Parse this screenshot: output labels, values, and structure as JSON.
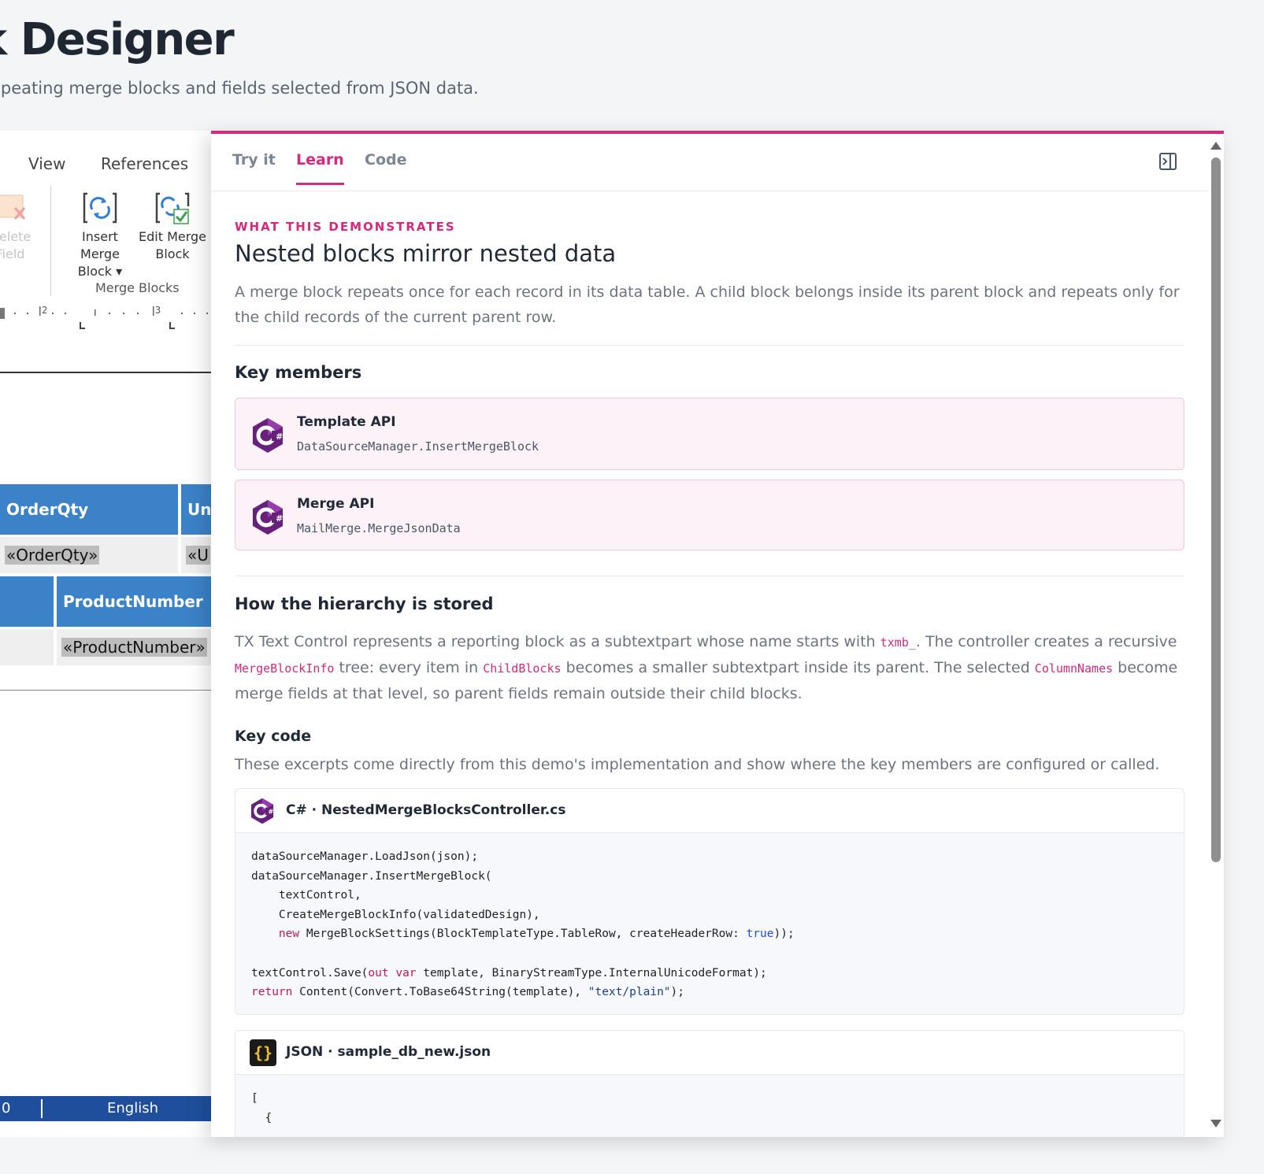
{
  "page": {
    "title": "k Designer",
    "subtitle": "epeating merge blocks and fields selected from JSON data."
  },
  "editor": {
    "ribbon_tabs": [
      "View",
      "References"
    ],
    "buttons": {
      "delete_field": [
        "Delete",
        "Field"
      ],
      "insert_merge_block": [
        "Insert Merge",
        "Block ▾"
      ],
      "edit_merge_block": [
        "Edit Merge",
        "Block"
      ]
    },
    "group_label": "Merge Blocks",
    "ruler_marks": [
      "2",
      "3"
    ],
    "table1": {
      "headers": [
        "OrderQty",
        "Un"
      ],
      "fields": [
        "«OrderQty»",
        "«U"
      ]
    },
    "table2": {
      "headers": [
        "ProductNumber"
      ],
      "fields": [
        "«ProductNumber»"
      ]
    },
    "statusbar": {
      "left_value": "0",
      "language": "English"
    }
  },
  "panel": {
    "tabs": [
      {
        "label": "Try it",
        "active": false
      },
      {
        "label": "Learn",
        "active": true
      },
      {
        "label": "Code",
        "active": false
      }
    ],
    "eyebrow": "WHAT THIS DEMONSTRATES",
    "heading": "Nested blocks mirror nested data",
    "lead": "A merge block repeats once for each record in its data table. A child block belongs inside its parent block and repeats only for the child records of the current parent row.",
    "key_members_title": "Key members",
    "members": [
      {
        "title": "Template API",
        "code": "DataSourceManager.InsertMergeBlock"
      },
      {
        "title": "Merge API",
        "code": "MailMerge.MergeJsonData"
      }
    ],
    "hierarchy_title": "How the hierarchy is stored",
    "hierarchy": {
      "t1": "TX Text Control represents a reporting block as a subtextpart whose name starts with ",
      "c1": "txmb_",
      "t2": ". The controller creates a recursive ",
      "c2": "MergeBlockInfo",
      "t3": " tree: every item in ",
      "c3": "ChildBlocks",
      "t4": " becomes a smaller subtextpart inside its parent. The selected ",
      "c4": "ColumnNames",
      "t5": " become merge fields at that level, so parent fields remain outside their child blocks."
    },
    "key_code_title": "Key code",
    "key_code_desc": "These excerpts come directly from this demo's implementation and show where the key members are configured or called.",
    "code_blocks": [
      {
        "language": "C#",
        "file": "C# · NestedMergeBlocksController.cs",
        "lines": [
          "dataSourceManager.LoadJson(json);",
          "dataSourceManager.InsertMergeBlock(",
          "    textControl,",
          "    CreateMergeBlockInfo(validatedDesign),",
          "    new MergeBlockSettings(BlockTemplateType.TableRow, createHeaderRow: true));",
          "",
          "textControl.Save(out var template, BinaryStreamType.InternalUnicodeFormat);",
          "return Content(Convert.ToBase64String(template), \"text/plain\");"
        ]
      },
      {
        "language": "JSON",
        "file": "JSON · sample_db_new.json",
        "lines": [
          "[",
          "  {"
        ]
      }
    ]
  },
  "icons": {
    "csharp": "csharp-logo-icon",
    "json": "json-braces-icon",
    "collapse": "panel-collapse-icon",
    "insert_block": "insert-merge-block-icon",
    "edit_block": "edit-merge-block-icon",
    "delete_field": "delete-field-icon"
  },
  "colors": {
    "accent": "#d8277d",
    "table_header": "#3b82c8",
    "statusbar": "#1f4e9c"
  }
}
